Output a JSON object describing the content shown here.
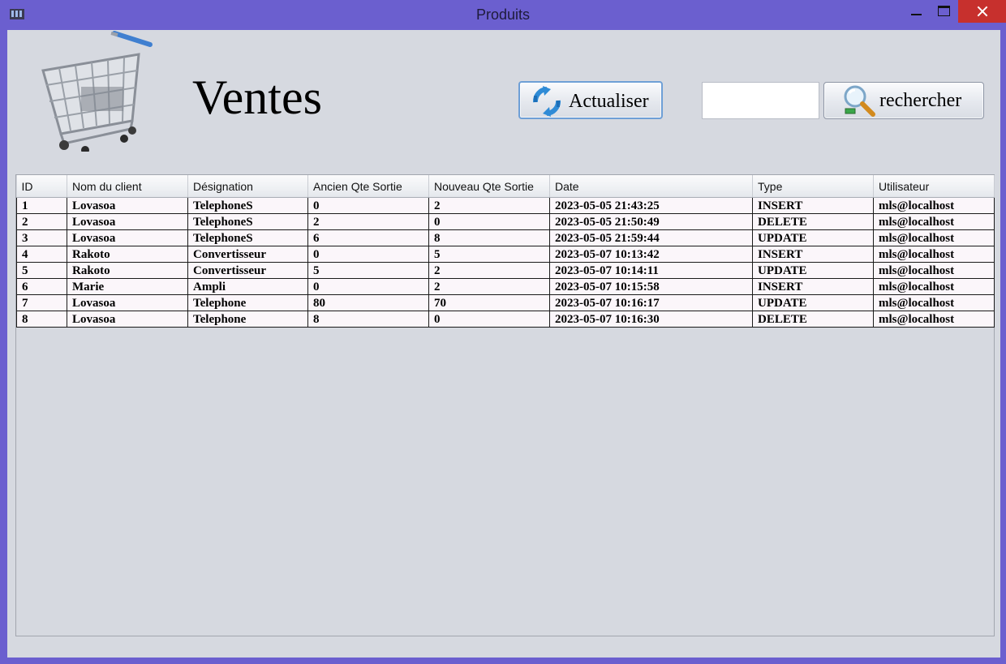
{
  "window": {
    "title": "Produits",
    "icon": "app-icon"
  },
  "header": {
    "title": "Ventes",
    "logo_icon": "shopping-cart-icon",
    "refresh_label": "Actualiser",
    "refresh_icon": "refresh-icon",
    "search_value": "",
    "search_label": "rechercher",
    "search_icon": "magnifier-icon"
  },
  "table": {
    "columns": [
      "ID",
      "Nom du client",
      "Désignation",
      "Ancien Qte Sortie",
      "Nouveau Qte Sortie",
      "Date",
      "Type",
      "Utilisateur"
    ],
    "rows": [
      [
        "1",
        "Lovasoa",
        "TelephoneS",
        "0",
        "2",
        "2023-05-05 21:43:25",
        "INSERT",
        "mls@localhost"
      ],
      [
        "2",
        "Lovasoa",
        "TelephoneS",
        "2",
        "0",
        "2023-05-05 21:50:49",
        "DELETE",
        "mls@localhost"
      ],
      [
        "3",
        "Lovasoa",
        "TelephoneS",
        "6",
        "8",
        "2023-05-05 21:59:44",
        "UPDATE",
        "mls@localhost"
      ],
      [
        "4",
        "Rakoto",
        "Convertisseur",
        "0",
        "5",
        "2023-05-07 10:13:42",
        "INSERT",
        "mls@localhost"
      ],
      [
        "5",
        "Rakoto",
        "Convertisseur",
        "5",
        "2",
        "2023-05-07 10:14:11",
        "UPDATE",
        "mls@localhost"
      ],
      [
        "6",
        "Marie",
        "Ampli",
        "0",
        "2",
        "2023-05-07 10:15:58",
        "INSERT",
        "mls@localhost"
      ],
      [
        "7",
        "Lovasoa",
        "Telephone",
        "80",
        "70",
        "2023-05-07 10:16:17",
        "UPDATE",
        "mls@localhost"
      ],
      [
        "8",
        "Lovasoa",
        "Telephone",
        "8",
        "0",
        "2023-05-07 10:16:30",
        "DELETE",
        "mls@localhost"
      ]
    ]
  },
  "colors": {
    "window_frame": "#6b5fcf",
    "close_button": "#c7302d",
    "panel_background": "#d6d9e0",
    "row_background": "#fbf6fa"
  }
}
